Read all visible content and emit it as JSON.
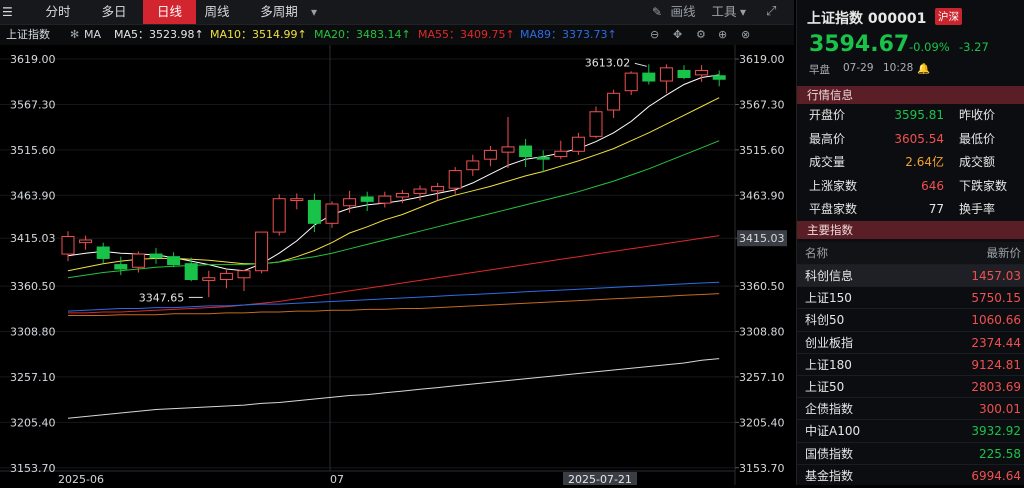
{
  "toolbar": {
    "tabs": [
      "分时",
      "多日",
      "日线",
      "周线",
      "多周期"
    ],
    "active": "日线",
    "draw_label": "画线",
    "tools_label": "工具"
  },
  "indicator_bar": {
    "index_name": "上证指数",
    "ma_label": "MA",
    "ma5": "MA5：3523.98↑",
    "ma10": "MA10：3514.99↑",
    "ma20": "MA20：3483.14↑",
    "ma55": "MA55：3409.75↑",
    "ma89": "MA89：3373.73↑"
  },
  "colors": {
    "up": "#f05050",
    "down": "#19c34a",
    "ma5": "#ffffff",
    "ma10": "#f0e040",
    "ma20": "#25c33c",
    "ma55": "#e02828",
    "ma89": "#2c6ce6",
    "ma120": "#c86a1e",
    "ma250": "#d8d8d8",
    "bg": "#000000",
    "accent": "#d3252f"
  },
  "chart_data": {
    "type": "candlestick",
    "y_ticks": [
      "3619.00",
      "3567.30",
      "3515.60",
      "3463.90",
      "3415.03",
      "3360.50",
      "3308.80",
      "3257.10",
      "3205.40",
      "3153.70"
    ],
    "y_tick_values": [
      3619.0,
      3567.3,
      3515.6,
      3463.9,
      3415.03,
      3360.5,
      3308.8,
      3257.1,
      3205.4,
      3153.7
    ],
    "ylim": [
      3150,
      3635
    ],
    "x_labels": [
      "2025-06",
      "07",
      "2025-07-21"
    ],
    "annotations": [
      "3613.02",
      "3347.65"
    ],
    "highlight_level": "3415.03",
    "candles": [
      [
        3397,
        3423,
        3389,
        3417
      ],
      [
        3410,
        3418,
        3402,
        3413
      ],
      [
        3405,
        3410,
        3386,
        3392
      ],
      [
        3385,
        3394,
        3373,
        3380
      ],
      [
        3382,
        3400,
        3376,
        3397
      ],
      [
        3397,
        3404,
        3386,
        3393
      ],
      [
        3394,
        3399,
        3382,
        3385
      ],
      [
        3386,
        3393,
        3366,
        3368
      ],
      [
        3367,
        3378,
        3348,
        3370
      ],
      [
        3368,
        3380,
        3358,
        3375
      ],
      [
        3370,
        3379,
        3355,
        3378
      ],
      [
        3378,
        3422,
        3375,
        3422
      ],
      [
        3422,
        3465,
        3418,
        3460
      ],
      [
        3458,
        3466,
        3448,
        3460
      ],
      [
        3458,
        3466,
        3422,
        3432
      ],
      [
        3432,
        3457,
        3427,
        3454
      ],
      [
        3452,
        3469,
        3444,
        3460
      ],
      [
        3462,
        3468,
        3446,
        3457
      ],
      [
        3455,
        3468,
        3450,
        3463
      ],
      [
        3462,
        3470,
        3455,
        3466
      ],
      [
        3466,
        3475,
        3458,
        3471
      ],
      [
        3469,
        3478,
        3458,
        3474
      ],
      [
        3472,
        3496,
        3465,
        3492
      ],
      [
        3493,
        3510,
        3486,
        3503
      ],
      [
        3505,
        3520,
        3497,
        3515
      ],
      [
        3513,
        3553,
        3495,
        3519
      ],
      [
        3520,
        3528,
        3496,
        3508
      ],
      [
        3507,
        3515,
        3490,
        3505
      ],
      [
        3508,
        3526,
        3505,
        3514
      ],
      [
        3514,
        3535,
        3510,
        3530
      ],
      [
        3531,
        3565,
        3529,
        3559
      ],
      [
        3561,
        3584,
        3552,
        3580
      ],
      [
        3583,
        3605,
        3578,
        3603
      ],
      [
        3603,
        3613,
        3590,
        3594
      ],
      [
        3594,
        3613,
        3580,
        3609
      ],
      [
        3606,
        3612,
        3596,
        3598
      ],
      [
        3601,
        3612,
        3593,
        3606
      ],
      [
        3600,
        3606,
        3588,
        3596
      ]
    ],
    "ma_series": {
      "ma5": [
        3395,
        3398,
        3400,
        3398,
        3397,
        3396,
        3393,
        3389,
        3385,
        3380,
        3378,
        3386,
        3398,
        3412,
        3430,
        3442,
        3449,
        3453,
        3455,
        3458,
        3462,
        3466,
        3470,
        3478,
        3488,
        3498,
        3505,
        3508,
        3512,
        3517,
        3525,
        3535,
        3548,
        3565,
        3578,
        3590,
        3598,
        3601
      ],
      "ma10": [
        3378,
        3382,
        3386,
        3389,
        3391,
        3392,
        3392,
        3391,
        3390,
        3388,
        3386,
        3386,
        3388,
        3394,
        3401,
        3410,
        3421,
        3428,
        3436,
        3442,
        3450,
        3458,
        3464,
        3469,
        3474,
        3480,
        3486,
        3491,
        3497,
        3503,
        3510,
        3517,
        3526,
        3535,
        3545,
        3555,
        3565,
        3575
      ],
      "ma20": [
        3370,
        3373,
        3376,
        3378,
        3380,
        3382,
        3383,
        3384,
        3385,
        3385,
        3385,
        3386,
        3388,
        3391,
        3394,
        3398,
        3403,
        3408,
        3413,
        3418,
        3423,
        3428,
        3433,
        3438,
        3443,
        3448,
        3453,
        3458,
        3463,
        3468,
        3474,
        3480,
        3487,
        3494,
        3502,
        3510,
        3518,
        3526
      ],
      "ma55": [
        3330,
        3330,
        3331,
        3331,
        3332,
        3333,
        3334,
        3335,
        3336,
        3337,
        3339,
        3341,
        3343,
        3346,
        3349,
        3352,
        3355,
        3358,
        3361,
        3364,
        3367,
        3370,
        3373,
        3376,
        3379,
        3382,
        3385,
        3388,
        3391,
        3394,
        3397,
        3400,
        3403,
        3406,
        3409,
        3412,
        3415,
        3418
      ],
      "ma89": [
        3332,
        3333,
        3334,
        3335,
        3335,
        3336,
        3336,
        3337,
        3338,
        3338,
        3339,
        3340,
        3340,
        3341,
        3342,
        3343,
        3344,
        3345,
        3346,
        3347,
        3348,
        3349,
        3350,
        3351,
        3352,
        3353,
        3354,
        3355,
        3356,
        3357,
        3358,
        3359,
        3360,
        3361,
        3362,
        3363,
        3364,
        3365
      ],
      "ma120": [
        3327,
        3327,
        3327,
        3328,
        3328,
        3328,
        3329,
        3329,
        3329,
        3330,
        3330,
        3331,
        3331,
        3332,
        3332,
        3333,
        3333,
        3334,
        3334,
        3335,
        3335,
        3336,
        3337,
        3338,
        3339,
        3340,
        3341,
        3342,
        3343,
        3344,
        3345,
        3346,
        3347,
        3348,
        3349,
        3350,
        3351,
        3352
      ],
      "ma250": [
        3210,
        3212,
        3214,
        3216,
        3218,
        3220,
        3221,
        3222,
        3223,
        3224,
        3225,
        3227,
        3228,
        3230,
        3232,
        3234,
        3236,
        3237,
        3239,
        3241,
        3243,
        3245,
        3247,
        3249,
        3251,
        3253,
        3255,
        3257,
        3259,
        3261,
        3263,
        3265,
        3267,
        3269,
        3271,
        3273,
        3276,
        3278
      ]
    }
  },
  "quote": {
    "title": "上证指数 000001",
    "market_badge": "沪深",
    "price": "3594.67",
    "change_pct": "-0.09%",
    "change": "-3.27",
    "session": "早盘",
    "date": "07-29",
    "time": "10:28",
    "section_market": "行情信息",
    "rows": [
      {
        "l1": "开盘价",
        "v1": "3595.81",
        "c1": "green",
        "l2": "昨收价"
      },
      {
        "l1": "最高价",
        "v1": "3605.54",
        "c1": "red",
        "l2": "最低价"
      },
      {
        "l1": "成交量",
        "v1": "2.64亿",
        "c1": "orange",
        "l2": "成交额"
      },
      {
        "l1": "上涨家数",
        "v1": "646",
        "c1": "red",
        "l2": "下跌家数"
      },
      {
        "l1": "平盘家数",
        "v1": "77",
        "c1": "white",
        "l2": "换手率"
      }
    ],
    "section_indices": "主要指数",
    "col_name": "名称",
    "col_price": "最新价",
    "indices": [
      {
        "name": "科创信息",
        "price": "1457.03",
        "color": "red"
      },
      {
        "name": "上证150",
        "price": "5750.15",
        "color": "red"
      },
      {
        "name": "科创50",
        "price": "1060.66",
        "color": "red"
      },
      {
        "name": "创业板指",
        "price": "2374.44",
        "color": "red"
      },
      {
        "name": "上证180",
        "price": "9124.81",
        "color": "red"
      },
      {
        "name": "上证50",
        "price": "2803.69",
        "color": "red"
      },
      {
        "name": "企债指数",
        "price": "300.01",
        "color": "red"
      },
      {
        "name": "中证A100",
        "price": "3932.92",
        "color": "green"
      },
      {
        "name": "国债指数",
        "price": "225.58",
        "color": "green"
      },
      {
        "name": "基金指数",
        "price": "6994.64",
        "color": "red"
      }
    ]
  }
}
